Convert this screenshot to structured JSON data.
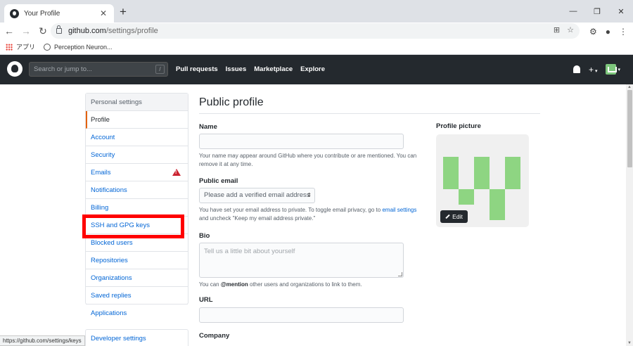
{
  "browser": {
    "tab_title": "Your Profile",
    "tab_close": "✕",
    "new_tab": "+",
    "url_host": "github.com",
    "url_path": "/settings/profile",
    "bookmarks": [
      "アプリ",
      "Perception Neuron..."
    ],
    "win_minimize": "—",
    "win_restore": "❐",
    "win_close": "✕"
  },
  "header": {
    "search_placeholder": "Search or jump to...",
    "slash_key": "/",
    "nav": [
      "Pull requests",
      "Issues",
      "Marketplace",
      "Explore"
    ],
    "plus": "+",
    "caret": "▾"
  },
  "sidebar": {
    "heading": "Personal settings",
    "items": [
      "Profile",
      "Account",
      "Security",
      "Emails",
      "Notifications",
      "Billing",
      "SSH and GPG keys",
      "Blocked users",
      "Repositories",
      "Organizations",
      "Saved replies",
      "Applications"
    ],
    "selected": "Profile",
    "developer": "Developer settings"
  },
  "main": {
    "title": "Public profile",
    "name_label": "Name",
    "name_note": "Your name may appear around GitHub where you contribute or are mentioned. You can remove it at any time.",
    "email_label": "Public email",
    "email_select": "Please add a verified email address",
    "email_note_1": "You have set your email address to private. To toggle email privacy, go to ",
    "email_note_link": "email settings",
    "email_note_2": " and uncheck \"Keep my email address private.\"",
    "bio_label": "Bio",
    "bio_placeholder": "Tell us a little bit about yourself",
    "bio_note_1": "You can ",
    "bio_note_mention": "@mention",
    "bio_note_2": " other users and organizations to link to them.",
    "url_label": "URL",
    "company_label": "Company",
    "picture_label": "Profile picture",
    "edit_label": "Edit"
  },
  "status_bar": "https://github.com/settings/keys",
  "colors": {
    "header_bg": "#24292e",
    "link": "#0366d6",
    "highlight": "#ff0000",
    "avatar": "#8ed582",
    "selected_border": "#e36209"
  }
}
